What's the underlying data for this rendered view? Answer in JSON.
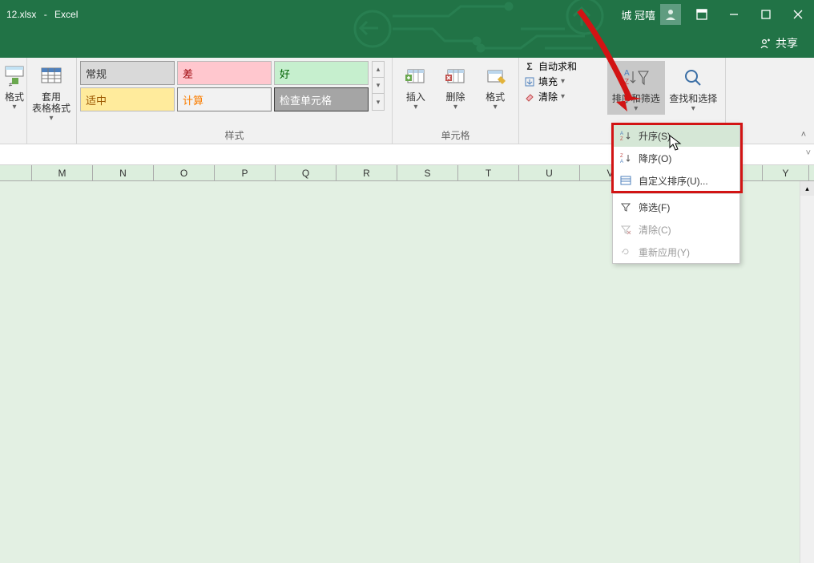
{
  "title": {
    "filename": "12.xlsx",
    "sep": "-",
    "app": "Excel"
  },
  "user": {
    "name": "城 冠嘻"
  },
  "share": {
    "label": "共享"
  },
  "ribbon": {
    "cond_format": {
      "label": "格式",
      "caret": "▾"
    },
    "table_format": {
      "line1": "套用",
      "line2": "表格格式",
      "caret": "▾"
    },
    "styles": {
      "group_label": "样式",
      "cells": {
        "changgui": "常规",
        "cha": "差",
        "hao": "好",
        "shizhong": "适中",
        "jisuan": "计算",
        "check": "检查单元格"
      }
    },
    "cells_group": {
      "group_label": "单元格",
      "insert": "插入",
      "delete": "删除",
      "format": "格式"
    },
    "editing": {
      "autosum": "自动求和",
      "fill": "填充",
      "clear": "清除"
    },
    "sort": {
      "label": "排序和筛选"
    },
    "find": {
      "label": "查找和选择"
    }
  },
  "columns": [
    "",
    "M",
    "N",
    "O",
    "P",
    "Q",
    "R",
    "S",
    "T",
    "U",
    "V",
    "",
    "",
    "Y"
  ],
  "menu": {
    "asc": "升序(S)",
    "desc": "降序(O)",
    "custom": "自定义排序(U)...",
    "filter": "筛选(F)",
    "clear": "清除(C)",
    "reapply": "重新应用(Y)"
  }
}
